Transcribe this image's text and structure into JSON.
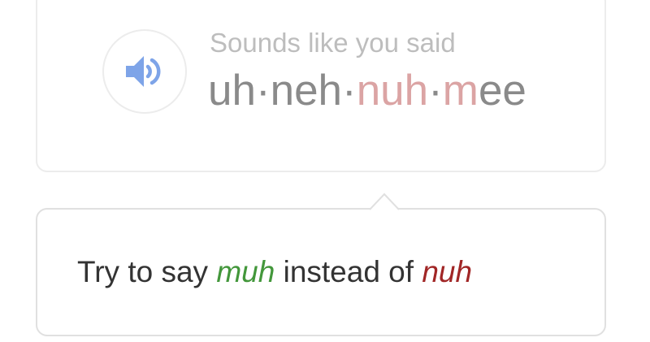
{
  "result": {
    "speaker_icon": "speaker-icon",
    "sounds_like_label": "Sounds like you said",
    "phonetic": [
      {
        "text": "uh",
        "state": "ok"
      },
      {
        "text": "·",
        "state": "ok"
      },
      {
        "text": "neh",
        "state": "ok"
      },
      {
        "text": "·",
        "state": "ok"
      },
      {
        "text": "nuh",
        "state": "bad"
      },
      {
        "text": "·",
        "state": "ok"
      },
      {
        "text": "m",
        "state": "bad"
      },
      {
        "text": "ee",
        "state": "ok"
      }
    ]
  },
  "feedback": {
    "prefix": "Try to say ",
    "correct_syllable": "muh",
    "middle": " instead of ",
    "wrong_syllable": "nuh"
  },
  "colors": {
    "phonetic_ok": "#8a8a8a",
    "phonetic_bad": "#dba4a4",
    "correct": "#43973b",
    "wrong": "#a12626",
    "speaker": "#7ea4e8"
  }
}
